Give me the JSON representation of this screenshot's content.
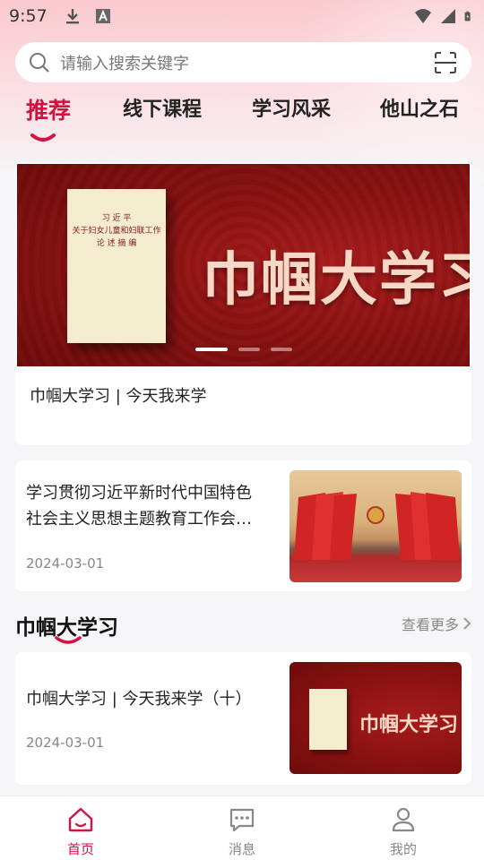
{
  "status_bar": {
    "time": "9:57",
    "icons_left": [
      "download-icon",
      "font-a-icon"
    ],
    "icons_right": [
      "wifi-icon",
      "signal-icon",
      "battery-charging-icon"
    ]
  },
  "search": {
    "placeholder": "请输入搜索关键字",
    "scan_icon": "scan-icon"
  },
  "tabs": [
    {
      "label": "推荐",
      "active": true
    },
    {
      "label": "线下课程",
      "active": false
    },
    {
      "label": "学习风采",
      "active": false
    },
    {
      "label": "他山之石",
      "active": false
    }
  ],
  "banner": {
    "image_title": "巾帼大学习",
    "book_lines": [
      "习 近 平",
      "关于妇女儿童和妇联工作",
      "论 述 摘 编"
    ],
    "caption": "巾帼大学习 | 今天我来学",
    "dots": 3,
    "active_dot": 0
  },
  "article": {
    "title": "学习贯彻习近平新时代中国特色社会主义思想主题教育工作会议召开",
    "date": "2024-03-01"
  },
  "section": {
    "title": "巾帼大学习",
    "more": "查看更多"
  },
  "item": {
    "title": "巾帼大学习 | 今天我来学（十）",
    "date": "2024-03-01",
    "thumb_title": "巾帼大学习"
  },
  "nav": [
    {
      "label": "首页",
      "icon": "home-icon",
      "active": true
    },
    {
      "label": "消息",
      "icon": "message-icon",
      "active": false
    },
    {
      "label": "我的",
      "icon": "user-icon",
      "active": false
    }
  ],
  "colors": {
    "accent": "#d31242",
    "banner_red": "#8c1212"
  }
}
